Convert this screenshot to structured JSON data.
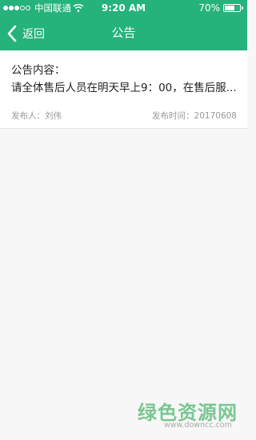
{
  "status": {
    "carrier": "中国联通",
    "time": "9:20 AM",
    "battery": "70%",
    "battery_level": 0.7,
    "signal_icon": "signal-dots-icon",
    "wifi_icon": "wifi-icon"
  },
  "nav": {
    "back_label": "返回",
    "back_icon": "chevron-left-icon",
    "title": "公告"
  },
  "notice": {
    "content_label": "公告内容：",
    "content_text": "请全体售后人员在明天早上9：00，在售后服...",
    "publisher": "发布人：刘伟",
    "publish_time": "发布时间：20170608"
  },
  "watermark": {
    "logo_text": "绿色资源网",
    "url": "www.downcc.com"
  },
  "colors": {
    "accent": "#25b27b",
    "background": "#f7f7f7"
  }
}
